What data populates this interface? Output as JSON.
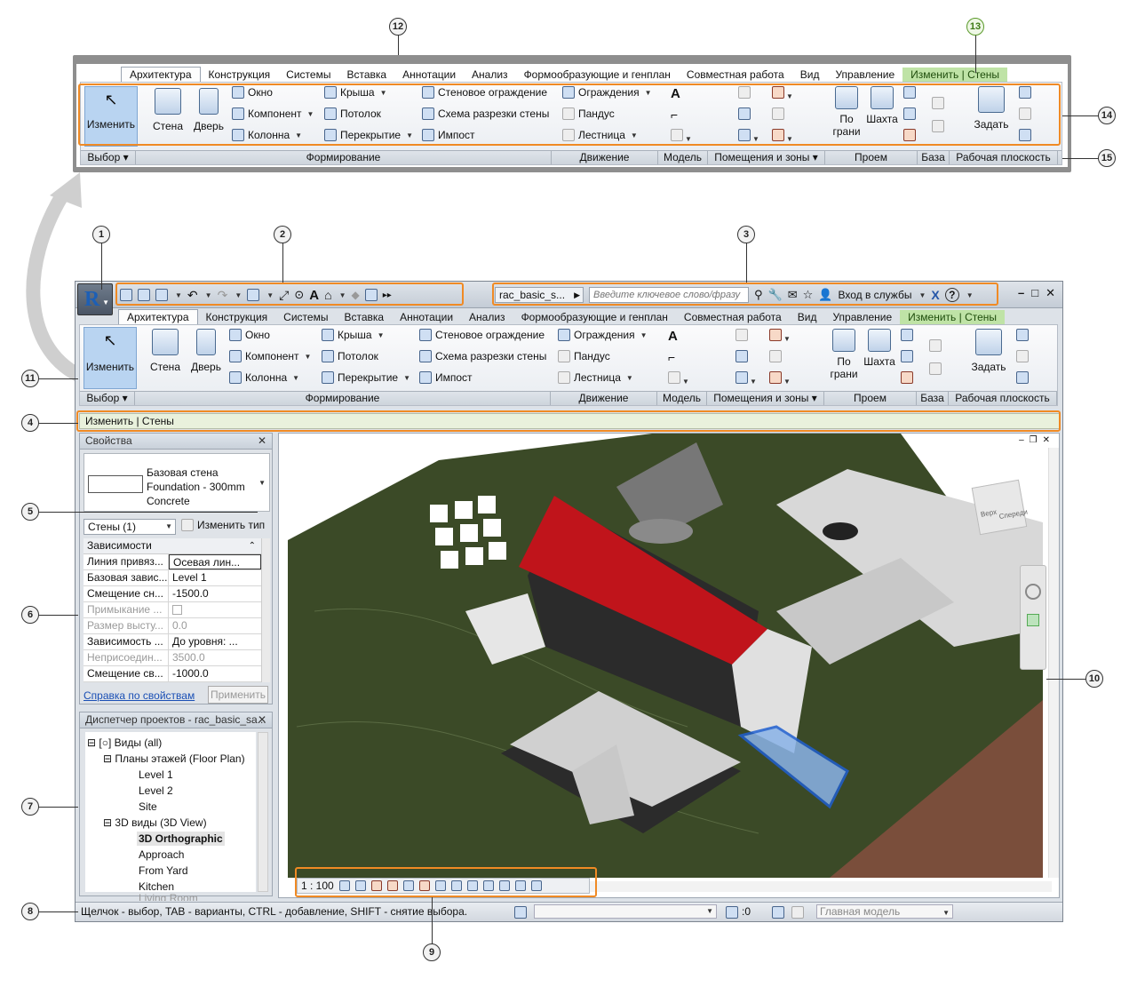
{
  "ribbon_tabs": [
    "Архитектура",
    "Конструкция",
    "Системы",
    "Вставка",
    "Аннотации",
    "Анализ",
    "Формообразующие и генплан",
    "Совместная работа",
    "Вид",
    "Управление",
    "Изменить | Стены"
  ],
  "ribbon_buttons": {
    "modify": "Изменить",
    "wall": "Стена",
    "door": "Дверь",
    "window": "Окно",
    "component": "Компонент",
    "column": "Колонна",
    "roof": "Крыша",
    "ceiling": "Потолок",
    "floor": "Перекрытие",
    "curtain_system": "Стеновое ограждение",
    "curtain_grid": "Схема разрезки стены",
    "mullion": "Импост",
    "railing": "Ограждения",
    "ramp": "Пандус",
    "stair": "Лестница",
    "by_face": "По грани",
    "shaft": "Шахта",
    "set": "Задать"
  },
  "ribbon_panels": [
    "Выбор",
    "Формирование",
    "Движение",
    "Модель",
    "Помещения и зоны",
    "Проем",
    "База",
    "Рабочая плоскость"
  ],
  "titlebar": {
    "filename": "rac_basic_s...",
    "search_placeholder": "Введите ключевое слово/фразу",
    "signin": "Вход в службы"
  },
  "options_bar": "Изменить | Стены",
  "properties": {
    "title": "Свойства",
    "type_line1": "Базовая стена",
    "type_line2": "Foundation - 300mm",
    "type_line3": "Concrete",
    "selector": "Стены (1)",
    "edit_type": "Изменить тип",
    "group": "Зависимости",
    "rows": [
      {
        "k": "Линия привяз...",
        "v": "Осевая лин..."
      },
      {
        "k": "Базовая завис...",
        "v": "Level 1"
      },
      {
        "k": "Смещение сн...",
        "v": "-1500.0"
      },
      {
        "k": "Примыкание ...",
        "v": ""
      },
      {
        "k": "Размер высту...",
        "v": "0.0"
      },
      {
        "k": "Зависимость ...",
        "v": "До уровня: ..."
      },
      {
        "k": "Неприсоедин...",
        "v": "3500.0"
      },
      {
        "k": "Смещение св...",
        "v": "-1000.0"
      }
    ],
    "help_link": "Справка по свойствам",
    "apply": "Применить"
  },
  "browser": {
    "title": "Диспетчер проектов - rac_basic_sa...",
    "views_all": "Виды (all)",
    "floor_plans": "Планы этажей (Floor Plan)",
    "level1": "Level 1",
    "level2": "Level 2",
    "site": "Site",
    "views3d": "3D виды (3D View)",
    "ortho": "3D Orthographic",
    "approach": "Approach",
    "from_yard": "From Yard",
    "kitchen": "Kitchen",
    "living_room": "Living Room"
  },
  "viewcube": {
    "top": "Верх",
    "front": "Спереди"
  },
  "view_scale": "1 : 100",
  "status": {
    "hint": "Щелчок - выбор, TAB - варианты, CTRL - добавление, SHIFT - снятие выбора.",
    "count": ":0",
    "model": "Главная модель"
  },
  "callouts": [
    "1",
    "2",
    "3",
    "4",
    "5",
    "6",
    "7",
    "8",
    "9",
    "10",
    "11",
    "12",
    "13",
    "14",
    "15"
  ],
  "colors": {
    "roof": "#c0141b",
    "terrain": "#3b4a27",
    "accent": "#f08a24",
    "context_tab": "#bfe3a6"
  }
}
